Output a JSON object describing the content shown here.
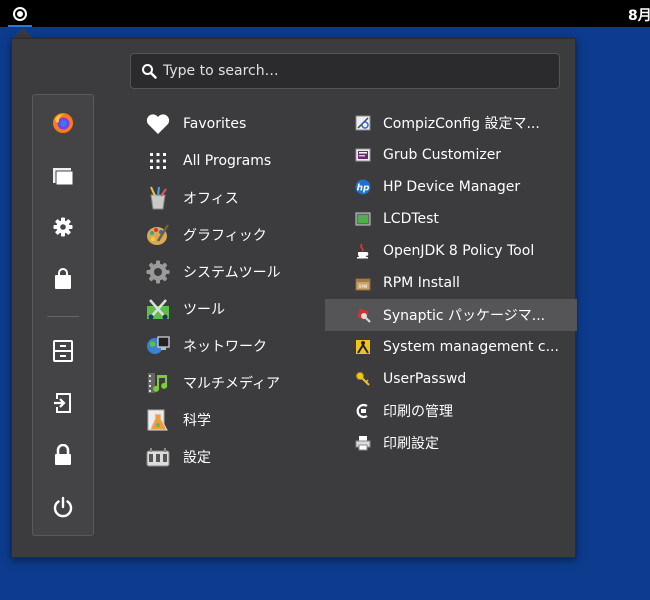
{
  "topbar": {
    "menu_icon": "cinnamon-menu-icon",
    "clock": "8月"
  },
  "search": {
    "placeholder": "Type to search…",
    "value": ""
  },
  "sidebar": {
    "items": [
      {
        "icon": "firefox-icon"
      },
      {
        "icon": "folder-icon"
      },
      {
        "icon": "gear-icon"
      },
      {
        "icon": "shopping-bag-icon"
      },
      {
        "icon": "file-cabinet-icon"
      },
      {
        "icon": "logout-icon"
      },
      {
        "icon": "lock-icon"
      },
      {
        "icon": "power-icon"
      }
    ]
  },
  "categories": [
    {
      "label": "Favorites",
      "icon": "heart-icon"
    },
    {
      "label": "All Programs",
      "icon": "grid-icon"
    },
    {
      "label": "オフィス",
      "icon": "office-icon"
    },
    {
      "label": "グラフィック",
      "icon": "graphics-icon"
    },
    {
      "label": "システムツール",
      "icon": "system-tools-icon"
    },
    {
      "label": "ツール",
      "icon": "accessories-icon"
    },
    {
      "label": "ネットワーク",
      "icon": "network-icon"
    },
    {
      "label": "マルチメディア",
      "icon": "multimedia-icon"
    },
    {
      "label": "科学",
      "icon": "science-icon"
    },
    {
      "label": "設定",
      "icon": "settings-icon"
    }
  ],
  "apps": [
    {
      "label": "CompizConfig 設定マ...",
      "icon": "compizconfig-icon"
    },
    {
      "label": "Grub Customizer",
      "icon": "grub-customizer-icon"
    },
    {
      "label": "HP Device Manager",
      "icon": "hp-icon"
    },
    {
      "label": "LCDTest",
      "icon": "lcdtest-icon"
    },
    {
      "label": "OpenJDK 8 Policy Tool",
      "icon": "java-icon"
    },
    {
      "label": "RPM Install",
      "icon": "rpm-icon"
    },
    {
      "label": "Synaptic パッケージマ...",
      "icon": "synaptic-icon"
    },
    {
      "label": "System management c...",
      "icon": "system-management-icon"
    },
    {
      "label": "UserPasswd",
      "icon": "userpasswd-icon"
    },
    {
      "label": "印刷の管理",
      "icon": "print-manager-icon"
    },
    {
      "label": "印刷設定",
      "icon": "print-settings-icon"
    }
  ],
  "colors": {
    "desktop": "#0d3c8f",
    "panel": "#3c3c3f",
    "hover_row": "#555558",
    "accent": "#2a78d6"
  }
}
